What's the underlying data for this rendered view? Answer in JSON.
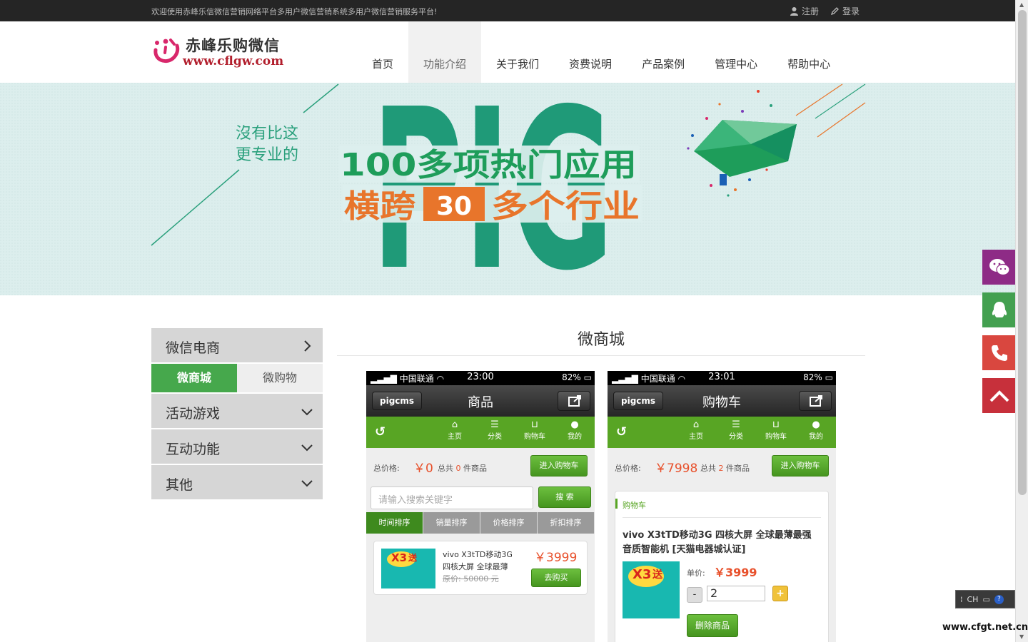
{
  "topbar": {
    "welcome": "欢迎使用赤峰乐信微信营销网络平台多用户微信营销系统多用户微信营销服务平台!",
    "register": "注册",
    "login": "登录"
  },
  "logo": {
    "name": "赤峰乐购微信",
    "url": "www.cflgw.com"
  },
  "nav": [
    "首页",
    "功能介绍",
    "关于我们",
    "资费说明",
    "产品案例",
    "管理中心",
    "帮助中心"
  ],
  "nav_active": "功能介绍",
  "banner": {
    "slogan_1": "沒有比这",
    "slogan_2": "更专业的",
    "headline_1": "100多项热门应用",
    "headline_2a": "横跨",
    "headline_2b": "30",
    "headline_2c": "多个行业",
    "bg_word": "PIG",
    "colors": {
      "teal": "#1f9a78",
      "orange": "#e8752b",
      "green": "#1e9d5a"
    }
  },
  "sidemenu": {
    "groups": [
      "微信电商",
      "活动游戏",
      "互动功能",
      "其他"
    ],
    "sub": [
      "微商城",
      "微购物"
    ]
  },
  "section": {
    "title": "微商城"
  },
  "phones": {
    "status": {
      "carrier": "中国联通",
      "battery": "82%"
    },
    "brand": "pigcms",
    "tabs": [
      "主页",
      "分类",
      "购物车",
      "我的"
    ],
    "total_label": "总价格:",
    "count_prefix": "总共",
    "count_suffix": "件商品",
    "enter_cart": "进入购物车",
    "left": {
      "time": "23:00",
      "title": "商品",
      "total": "￥0",
      "count": "0",
      "search_placeholder": "请输入搜索关键字",
      "search_btn": "搜 索",
      "sorts": [
        "时间排序",
        "销量排序",
        "价格排序",
        "折扣排序"
      ],
      "product": {
        "name_1": "vivo X3tTD移动3G",
        "name_2": "四核大屏 全球最薄",
        "old_price": "原价: 50000 元",
        "price": "￥3999",
        "buy": "去购买"
      }
    },
    "right": {
      "time": "23:01",
      "title": "购物车",
      "total": "￥7998",
      "count": "2",
      "cart_label": "购物车",
      "product_name_1": "vivo X3tTD移动3G 四核大屏 全球最薄最强",
      "product_name_2": "音质智能机 [天猫电器城认证]",
      "unit_label": "单价:",
      "unit_price": "￥3999",
      "qty": "2",
      "minus": "-",
      "plus": "+",
      "delete": "删除商品"
    },
    "img_word": "X3",
    "img_send": "送"
  },
  "float": {
    "colors": [
      "#8e2b86",
      "#43a050",
      "#d9473f",
      "#c7303b"
    ]
  },
  "ime": {
    "label": "CH"
  },
  "watermark": "www.cfgt.net.cn"
}
